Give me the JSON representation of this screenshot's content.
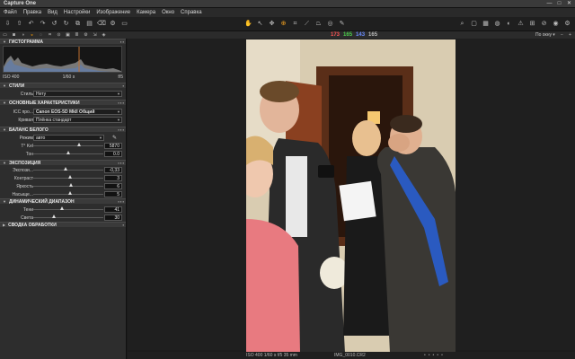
{
  "window": {
    "title": "Capture One",
    "buttons": [
      "—",
      "□",
      "✕"
    ]
  },
  "menu": [
    "Файл",
    "Правка",
    "Вид",
    "Настройки",
    "Изображение",
    "Камера",
    "Окно",
    "Справка"
  ],
  "toolbar": {
    "left_icons": [
      "import-icon",
      "export-icon",
      "undo-icon",
      "redo-icon",
      "rotate-left-icon",
      "rotate-right-icon",
      "copy-icon",
      "paste-icon",
      "delete-icon",
      "process-icon",
      "folder-icon"
    ],
    "mid_icons": [
      "hand-icon",
      "select-icon",
      "pan-icon",
      "zoom-icon",
      "crop-icon",
      "straighten-icon",
      "keystone-icon",
      "spot-icon",
      "picker-icon"
    ],
    "right_icons": [
      "search-icon",
      "viewer-icon",
      "browser-icon",
      "focus-icon",
      "compare-icon",
      "exposure-warning-icon",
      "grid-icon",
      "guides-icon",
      "proof-icon",
      "settings-icon"
    ]
  },
  "subbar": {
    "rgb": {
      "r": "173",
      "g": "165",
      "b": "143",
      "k": "165"
    },
    "zoom_label": "По окну"
  },
  "panel": {
    "histogram": {
      "title": "ГИСТОГРАММА",
      "iso": "ISO 400",
      "shutter": "1/60 s",
      "aperture": "f/5"
    },
    "styles": {
      "title": "СТИЛИ",
      "label": "Стиль",
      "value": "Нету"
    },
    "characteristics": {
      "title": "ОСНОВНЫЕ ХАРАКТЕРИСТИКИ",
      "icc_label": "ICC про...",
      "icc_value": "Canon EOS-5D MkII Общий",
      "curve_label": "Кривая",
      "curve_value": "Плёнка стандарт"
    },
    "white_balance": {
      "title": "БАЛАНС БЕЛОГО",
      "mode_label": "Режим",
      "mode_value": "авто",
      "temp_label": "T° Kel",
      "temp_value": "5870",
      "temp_pos": 0.66,
      "tint_label": "Тон",
      "tint_value": "0.0",
      "tint_pos": 0.5
    },
    "exposure": {
      "title": "ЭКСПОЗИЦИЯ",
      "rows": [
        {
          "label": "Экспози...",
          "value": "-0,33",
          "pos": 0.46
        },
        {
          "label": "Контраст",
          "value": "3",
          "pos": 0.52
        },
        {
          "label": "Яркость",
          "value": "6",
          "pos": 0.54
        },
        {
          "label": "Насыще...",
          "value": "5",
          "pos": 0.53
        }
      ]
    },
    "dynamic_range": {
      "title": "ДИНАМИЧЕСКИЙ ДИАПАЗОН",
      "rows": [
        {
          "label": "Тени",
          "value": "41",
          "pos": 0.41
        },
        {
          "label": "Света",
          "value": "30",
          "pos": 0.3
        }
      ]
    },
    "summary": {
      "title": "СВОДКА ОБРАБОТКИ"
    }
  },
  "status": {
    "meta": "ISO 400   1/60 s   f/5   35 mm",
    "filename": "IMG_0010.CR2",
    "rating": [
      "•",
      "•",
      "•",
      "•",
      "•"
    ]
  }
}
